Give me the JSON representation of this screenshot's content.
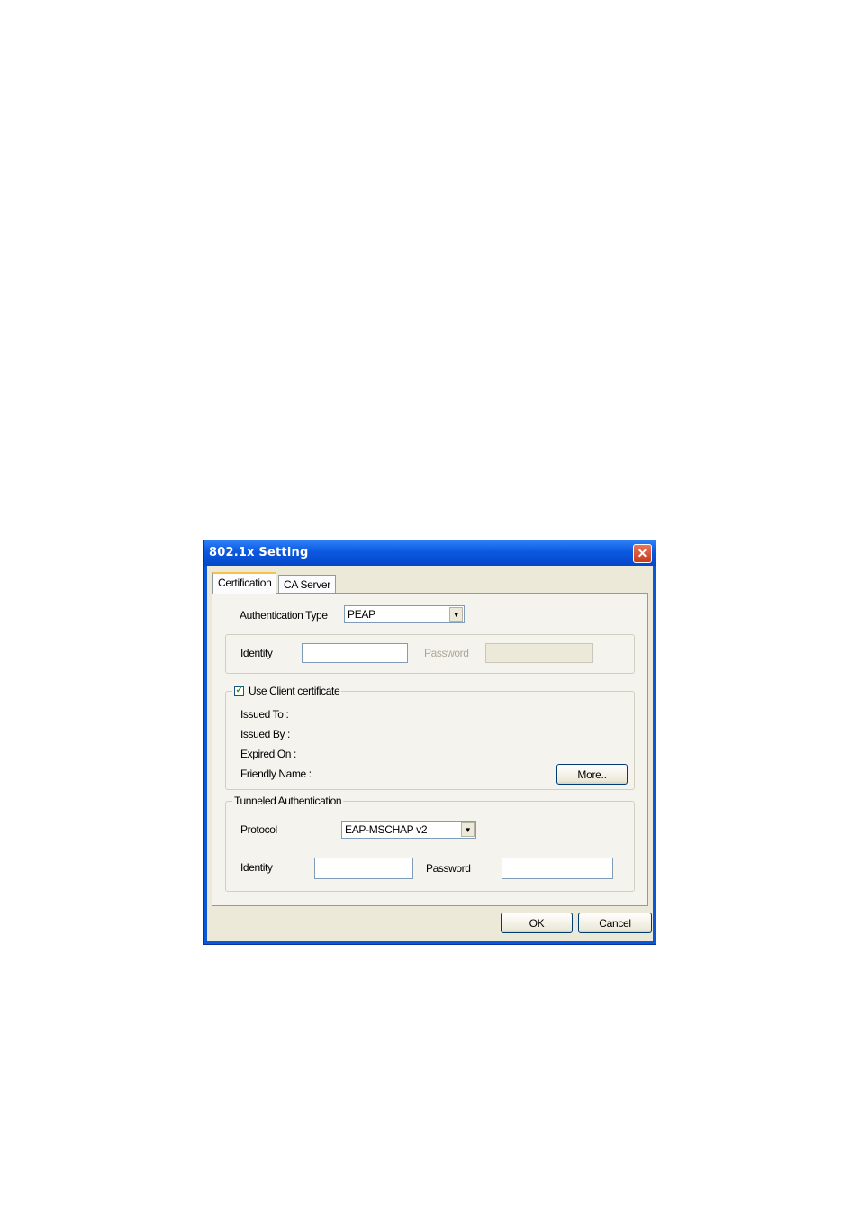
{
  "window": {
    "title": "802.1x Setting"
  },
  "tabs": [
    {
      "label": "Certification"
    },
    {
      "label": "CA Server"
    }
  ],
  "auth": {
    "type_label": "Authentication Type",
    "type_value": "PEAP",
    "identity_label": "Identity",
    "identity_value": "",
    "password_label": "Password",
    "password_value": ""
  },
  "client_cert": {
    "checkbox_label": "Use Client certificate",
    "checked": true,
    "issued_to_label": "Issued To :",
    "issued_by_label": "Issued By :",
    "expired_on_label": "Expired On :",
    "friendly_name_label": "Friendly Name :",
    "more_button": "More.."
  },
  "tunneled": {
    "legend": "Tunneled Authentication",
    "protocol_label": "Protocol",
    "protocol_value": "EAP-MSCHAP v2",
    "identity_label": "Identity",
    "identity_value": "",
    "password_label": "Password",
    "password_value": ""
  },
  "buttons": {
    "ok": "OK",
    "cancel": "Cancel"
  },
  "icons": {
    "close": "close-icon",
    "dropdown": "chevron-down-icon",
    "check": "checkmark-icon"
  }
}
